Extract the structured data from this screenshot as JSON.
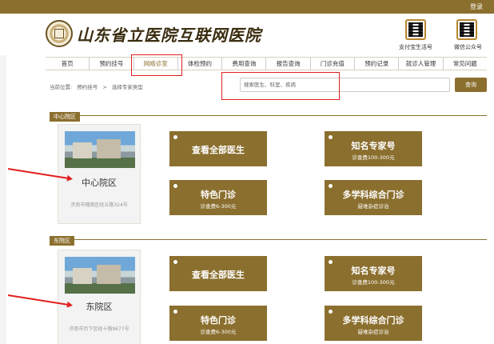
{
  "topbar": {
    "login": "登录"
  },
  "header": {
    "title": "山东省立医院互联网医院",
    "qr_alipay_label": "支付宝生活号",
    "qr_wechat_label": "微信公众号"
  },
  "nav": {
    "items": [
      "首页",
      "预约挂号",
      "网络诊室",
      "体检预约",
      "费用查询",
      "报告查询",
      "门诊充值",
      "预约记录",
      "就诊人管理",
      "常见问题"
    ]
  },
  "breadcrumb": {
    "prefix": "当前位置:",
    "level1": "预约挂号",
    "sep": ">",
    "level2": "选择专家类型"
  },
  "search": {
    "placeholder": "搜索医生、科室、疾病",
    "button": "查询"
  },
  "sections": [
    {
      "label": "中心院区",
      "campus_name": "中心院区",
      "campus_addr": "济南市槐荫区经五路324号",
      "buttons": [
        {
          "main": "查看全部医生",
          "sub": ""
        },
        {
          "main": "知名专家号",
          "sub": "诊查费100-300元"
        },
        {
          "main": "特色门诊",
          "sub": "诊查费6-300元"
        },
        {
          "main": "多学科综合门诊",
          "sub": "疑难杂症诊治"
        }
      ]
    },
    {
      "label": "东院区",
      "campus_name": "东院区",
      "campus_addr": "济南市历下区经十路9677号",
      "buttons": [
        {
          "main": "查看全部医生",
          "sub": ""
        },
        {
          "main": "知名专家号",
          "sub": "诊查费100-300元"
        },
        {
          "main": "特色门诊",
          "sub": "诊查费6-300元"
        },
        {
          "main": "多学科综合门诊",
          "sub": "疑难杂症诊治"
        }
      ]
    }
  ],
  "colors": {
    "brand": "#8b6f2e",
    "annotation": "#e02020"
  }
}
